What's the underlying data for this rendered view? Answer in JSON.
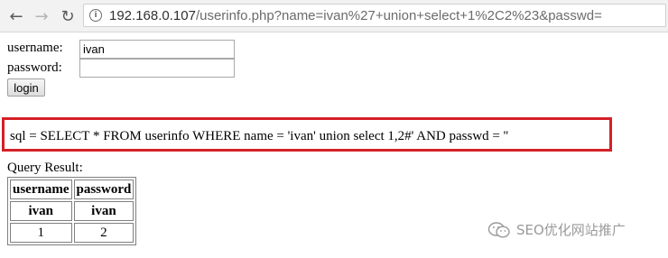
{
  "browser": {
    "url_host": "192.168.0.107",
    "url_path": "/userinfo.php?name=ivan%27+union+select+1%2C2%23&passwd="
  },
  "form": {
    "username_label": "username:",
    "username_value": "ivan",
    "password_label": "password:",
    "password_value": "",
    "login_label": "login"
  },
  "sql": {
    "query": "sql = SELECT * FROM userinfo WHERE name = 'ivan' union select 1,2#' AND passwd = ''"
  },
  "result": {
    "title": "Query Result:",
    "headers": [
      "username",
      "password"
    ],
    "rows": [
      [
        "ivan",
        "ivan"
      ],
      [
        "1",
        "2"
      ]
    ]
  },
  "watermark": {
    "text": "SEO优化网站推广"
  }
}
